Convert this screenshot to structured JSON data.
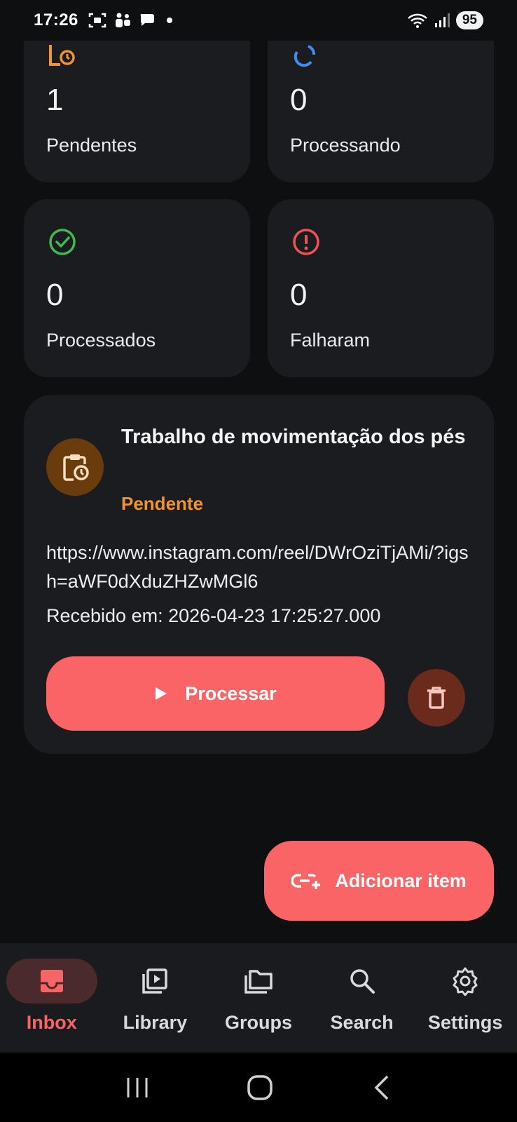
{
  "status_bar": {
    "time": "17:26",
    "battery": "95"
  },
  "stats": {
    "pending": {
      "value": "1",
      "label": "Pendentes",
      "icon": "pending-clock-icon",
      "color": "#f1942a"
    },
    "processing": {
      "value": "0",
      "label": "Processando",
      "icon": "sync-icon",
      "color": "#3b8ff0"
    },
    "processed": {
      "value": "0",
      "label": "Processados",
      "icon": "check-circle-icon",
      "color": "#3fb950"
    },
    "failed": {
      "value": "0",
      "label": "Falharam",
      "icon": "error-circle-icon",
      "color": "#f05252"
    }
  },
  "item": {
    "title": "Trabalho de movimentação dos pés",
    "status": "Pendente",
    "url": "https://www.instagram.com/reel/DWrOziTjAMi/?igsh=aWF0dXduZHZwMGl6",
    "received": "Recebido em: 2026-04-23 17:25:27.000",
    "process_label": "Processar"
  },
  "fab": {
    "label": "Adicionar item"
  },
  "nav": {
    "items": [
      {
        "label": "Inbox",
        "icon": "inbox-icon",
        "active": true
      },
      {
        "label": "Library",
        "icon": "video-library-icon",
        "active": false
      },
      {
        "label": "Groups",
        "icon": "folders-icon",
        "active": false
      },
      {
        "label": "Search",
        "icon": "search-icon",
        "active": false
      },
      {
        "label": "Settings",
        "icon": "gear-icon",
        "active": false
      }
    ]
  },
  "colors": {
    "accent": "#fb6467",
    "pending": "#f1942a",
    "background": "#0e0f11",
    "card": "#1b1c1f"
  }
}
